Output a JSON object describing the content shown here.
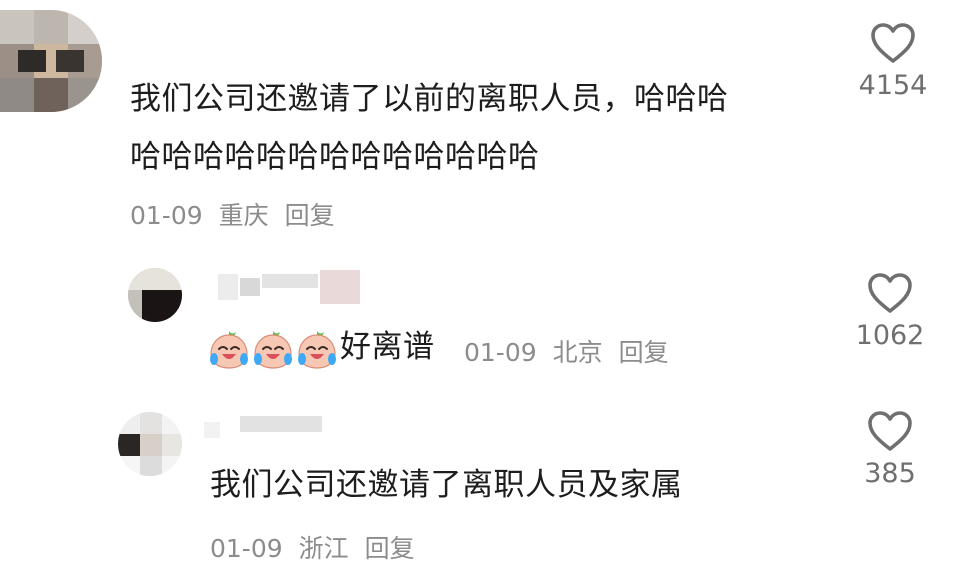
{
  "comments": [
    {
      "text": "我们公司还邀请了以前的离职人员，哈哈哈哈哈哈哈哈哈哈哈哈哈哈哈哈",
      "line1": "我们公司还邀请了以前的离职人员，哈哈哈",
      "line2": "哈哈哈哈哈哈哈哈哈哈哈哈哈",
      "date": "01-09",
      "location": "重庆",
      "reply_label": "回复",
      "likes": "4154"
    }
  ],
  "replies": [
    {
      "emoji_count": 3,
      "emoji_name": "crying-laughing-peach-emoji",
      "text": "好离谱",
      "date": "01-09",
      "location": "北京",
      "reply_label": "回复",
      "likes": "1062"
    },
    {
      "text": "我们公司还邀请了离职人员及家属",
      "date": "01-09",
      "location": "浙江",
      "reply_label": "回复",
      "likes": "385"
    }
  ],
  "icons": {
    "like": "heart-outline-icon"
  },
  "colors": {
    "text": "#1d1d1d",
    "meta": "#8c8c8c",
    "like_icon": "#6f6f6f"
  }
}
